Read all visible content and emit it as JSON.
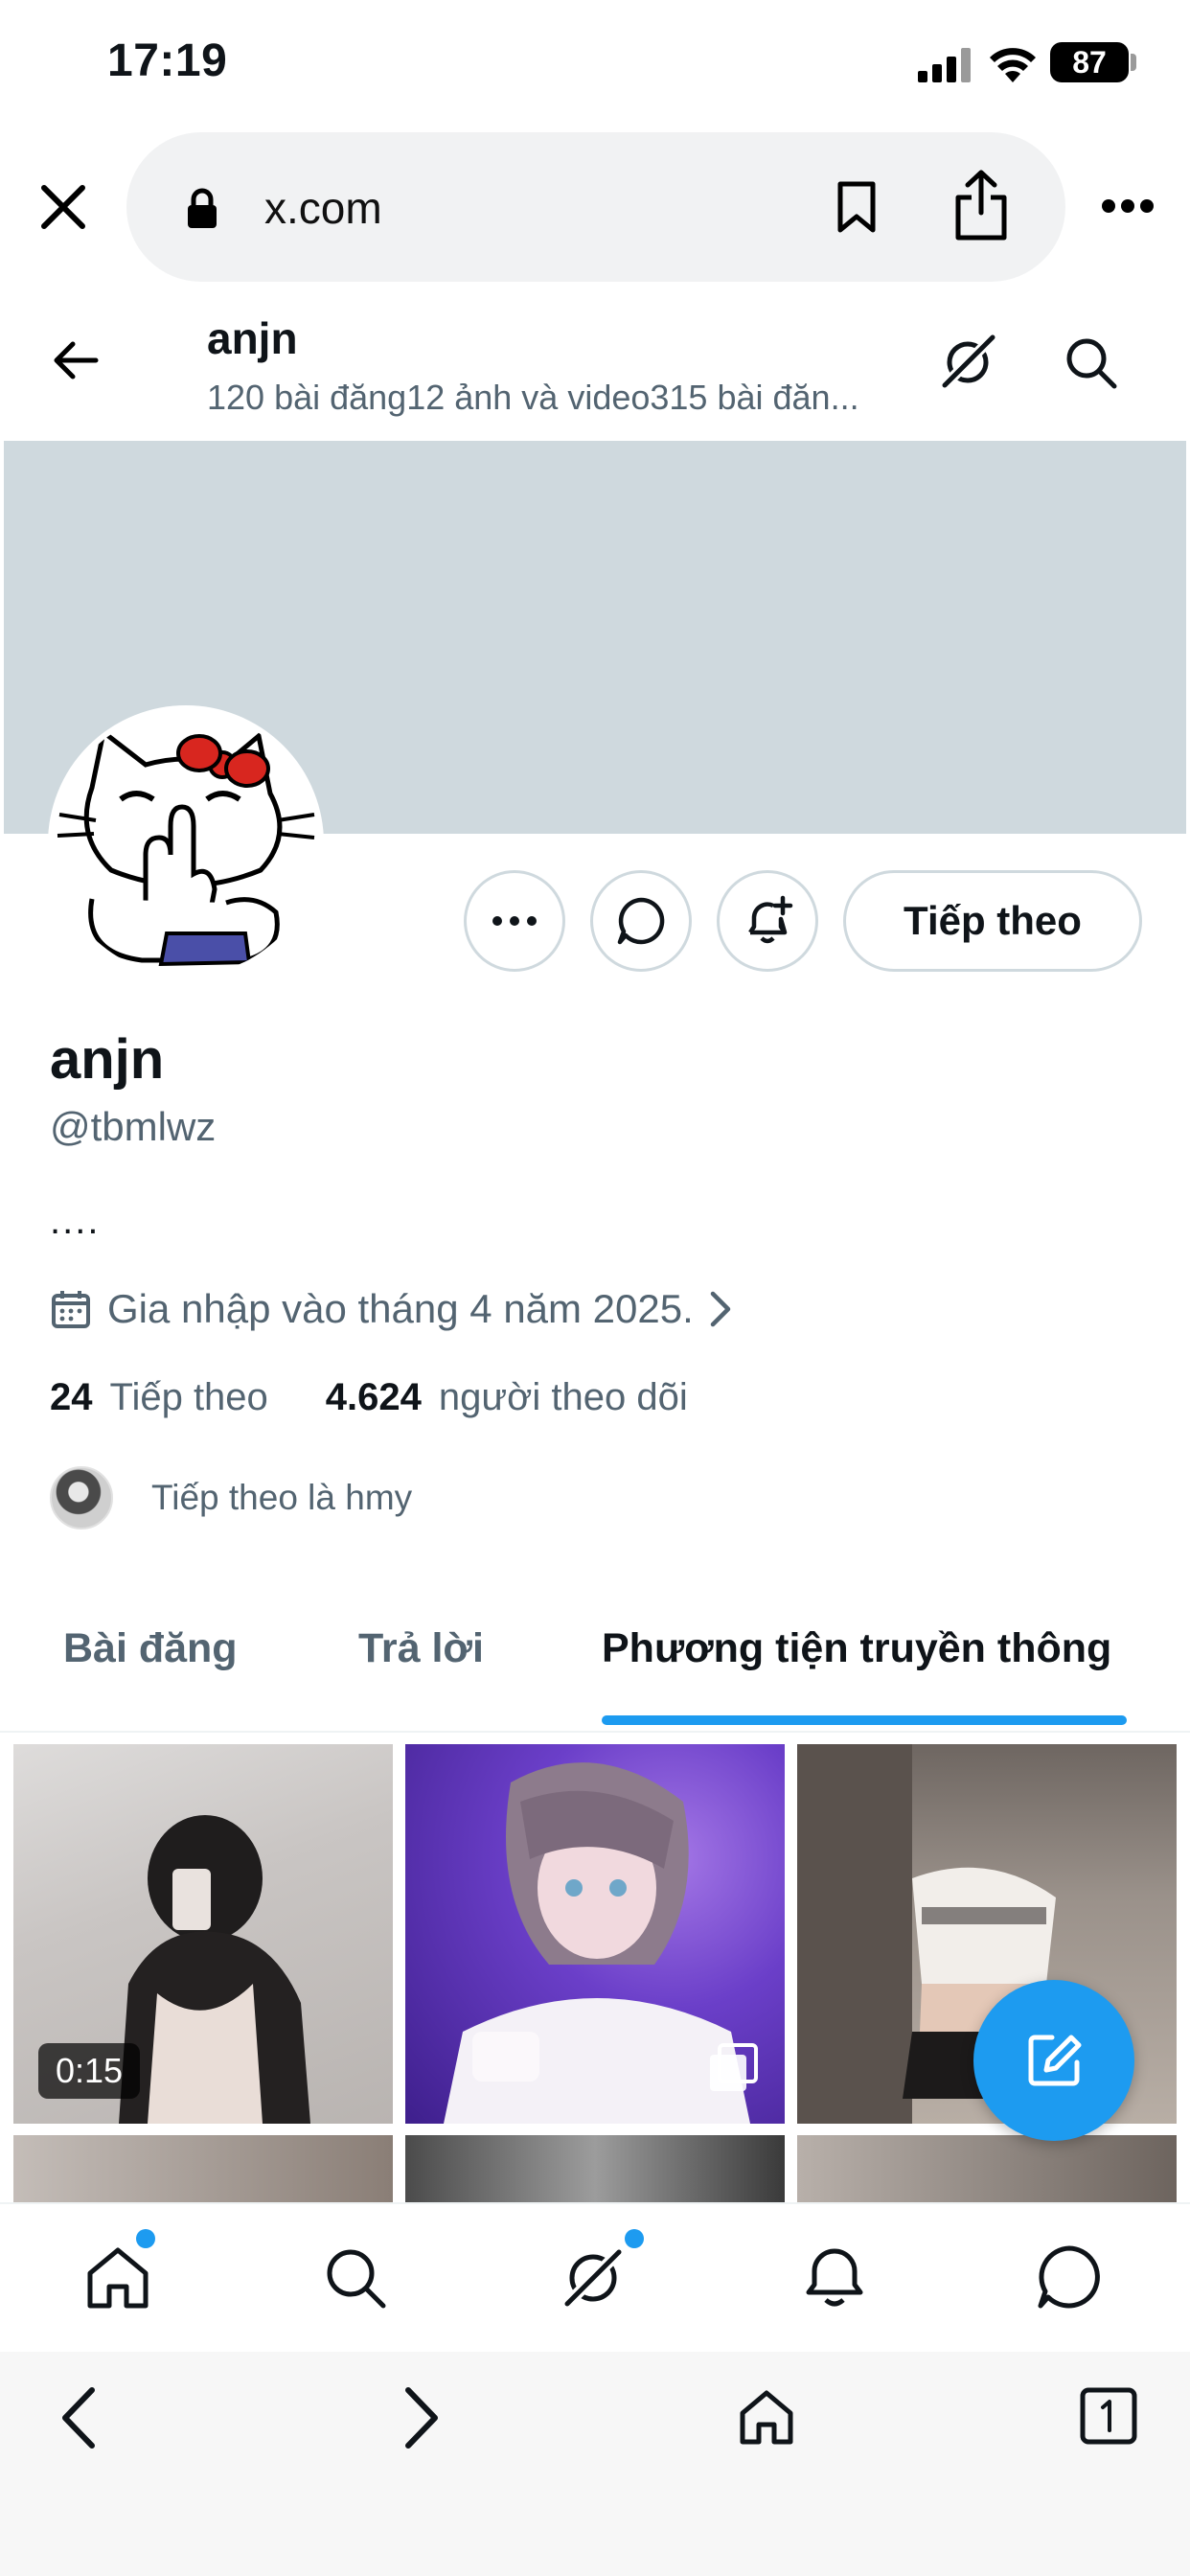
{
  "status_bar": {
    "time": "17:19",
    "battery": "87"
  },
  "browser": {
    "url": "x.com"
  },
  "header": {
    "name": "anjn",
    "subtitle": "120 bài đăng12 ảnh và video315 bài đăn..."
  },
  "profile": {
    "name": "anjn",
    "handle": "@tbmlwz",
    "bio": "....",
    "joined": "Gia nhập vào tháng 4 năm 2025.",
    "following_count": "24",
    "following_label": "Tiếp theo",
    "followers_count": "4.624",
    "followers_label": "người theo dõi",
    "followed_by": "Tiếp theo là hmy",
    "follow_button": "Tiếp theo"
  },
  "tabs": [
    {
      "label": "Bài đăng",
      "active": false
    },
    {
      "label": "Trả lời",
      "active": false
    },
    {
      "label": "Phương tiện truyền thông",
      "active": true
    }
  ],
  "media": [
    {
      "duration": "0:15"
    }
  ],
  "colors": {
    "accent": "#1d9bf0",
    "banner": "#cfd9de",
    "secondary_text": "#536471"
  },
  "icons": {
    "close": "close-icon",
    "lock": "lock-icon",
    "bookmark": "bookmark-icon",
    "share": "share-icon",
    "more": "more-icon",
    "back": "back-arrow-icon",
    "grok": "grok-icon",
    "search": "search-icon",
    "message": "message-icon",
    "notify": "bell-plus-icon",
    "calendar": "calendar-icon",
    "compose": "compose-icon"
  }
}
